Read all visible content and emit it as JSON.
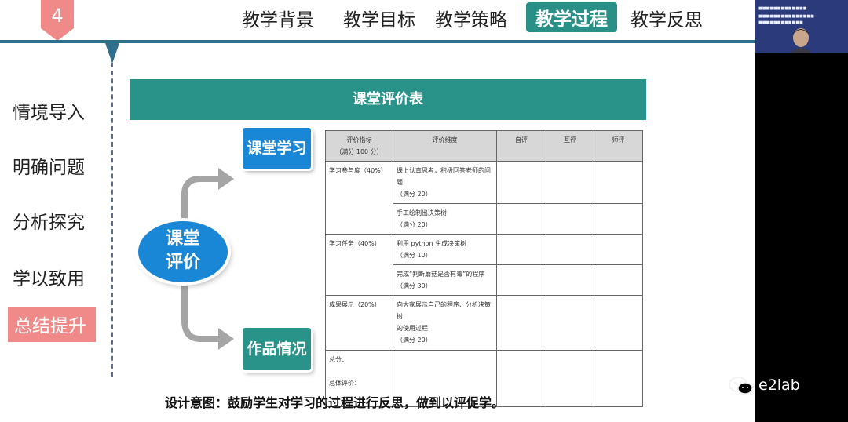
{
  "header": {
    "section_number": "4",
    "tabs": [
      {
        "label": "教学背景",
        "active": false
      },
      {
        "label": "教学目标",
        "active": false
      },
      {
        "label": "教学策略",
        "active": false
      },
      {
        "label": "教学过程",
        "active": true
      },
      {
        "label": "教学反思",
        "active": false
      }
    ]
  },
  "sidebar": {
    "items": [
      {
        "label": "情境导入",
        "active": false
      },
      {
        "label": "明确问题",
        "active": false
      },
      {
        "label": "分析探究",
        "active": false
      },
      {
        "label": "学以致用",
        "active": false
      },
      {
        "label": "总结提升",
        "active": true
      }
    ]
  },
  "diagram": {
    "center_line1": "课堂",
    "center_line2": "评价",
    "top_box": "课堂学习",
    "bottom_box": "作品情况"
  },
  "table": {
    "title": "课堂评价表",
    "headers": [
      "评价指标",
      "（满分 100 分）",
      "评价维度",
      "自评",
      "互评",
      "师评"
    ],
    "rows": [
      {
        "indicator": "学习参与度（40%）",
        "dimension": "课上认真思考，积极回答老师的问题",
        "score": "（满分 20）"
      },
      {
        "indicator": "",
        "dimension": "手工绘制出决策树",
        "score": "（满分 20）"
      },
      {
        "indicator": "学习任务（40%）",
        "dimension": "利用 python 生成决策树",
        "score": "（满分 10）"
      },
      {
        "indicator": "",
        "dimension": "完成“判断蘑菇是否有毒”的程序",
        "score": "（满分 30）"
      },
      {
        "indicator": "成果展示（20%）",
        "dimension": "向大家展示自己的程序、分析决策树",
        "dimension2": "的使用过程",
        "score": "（满分 20）"
      }
    ],
    "total_label": "总分：",
    "overall_label": "总体评价："
  },
  "footer": {
    "text": "设计意图：鼓励学生对学习的过程进行反思，做到以评促学。"
  },
  "watermark": {
    "text": "e2lab"
  },
  "colors": {
    "teal": "#2a9389",
    "blue": "#1a87d6",
    "pink": "#f08a88",
    "navy": "#2f6f8b"
  }
}
